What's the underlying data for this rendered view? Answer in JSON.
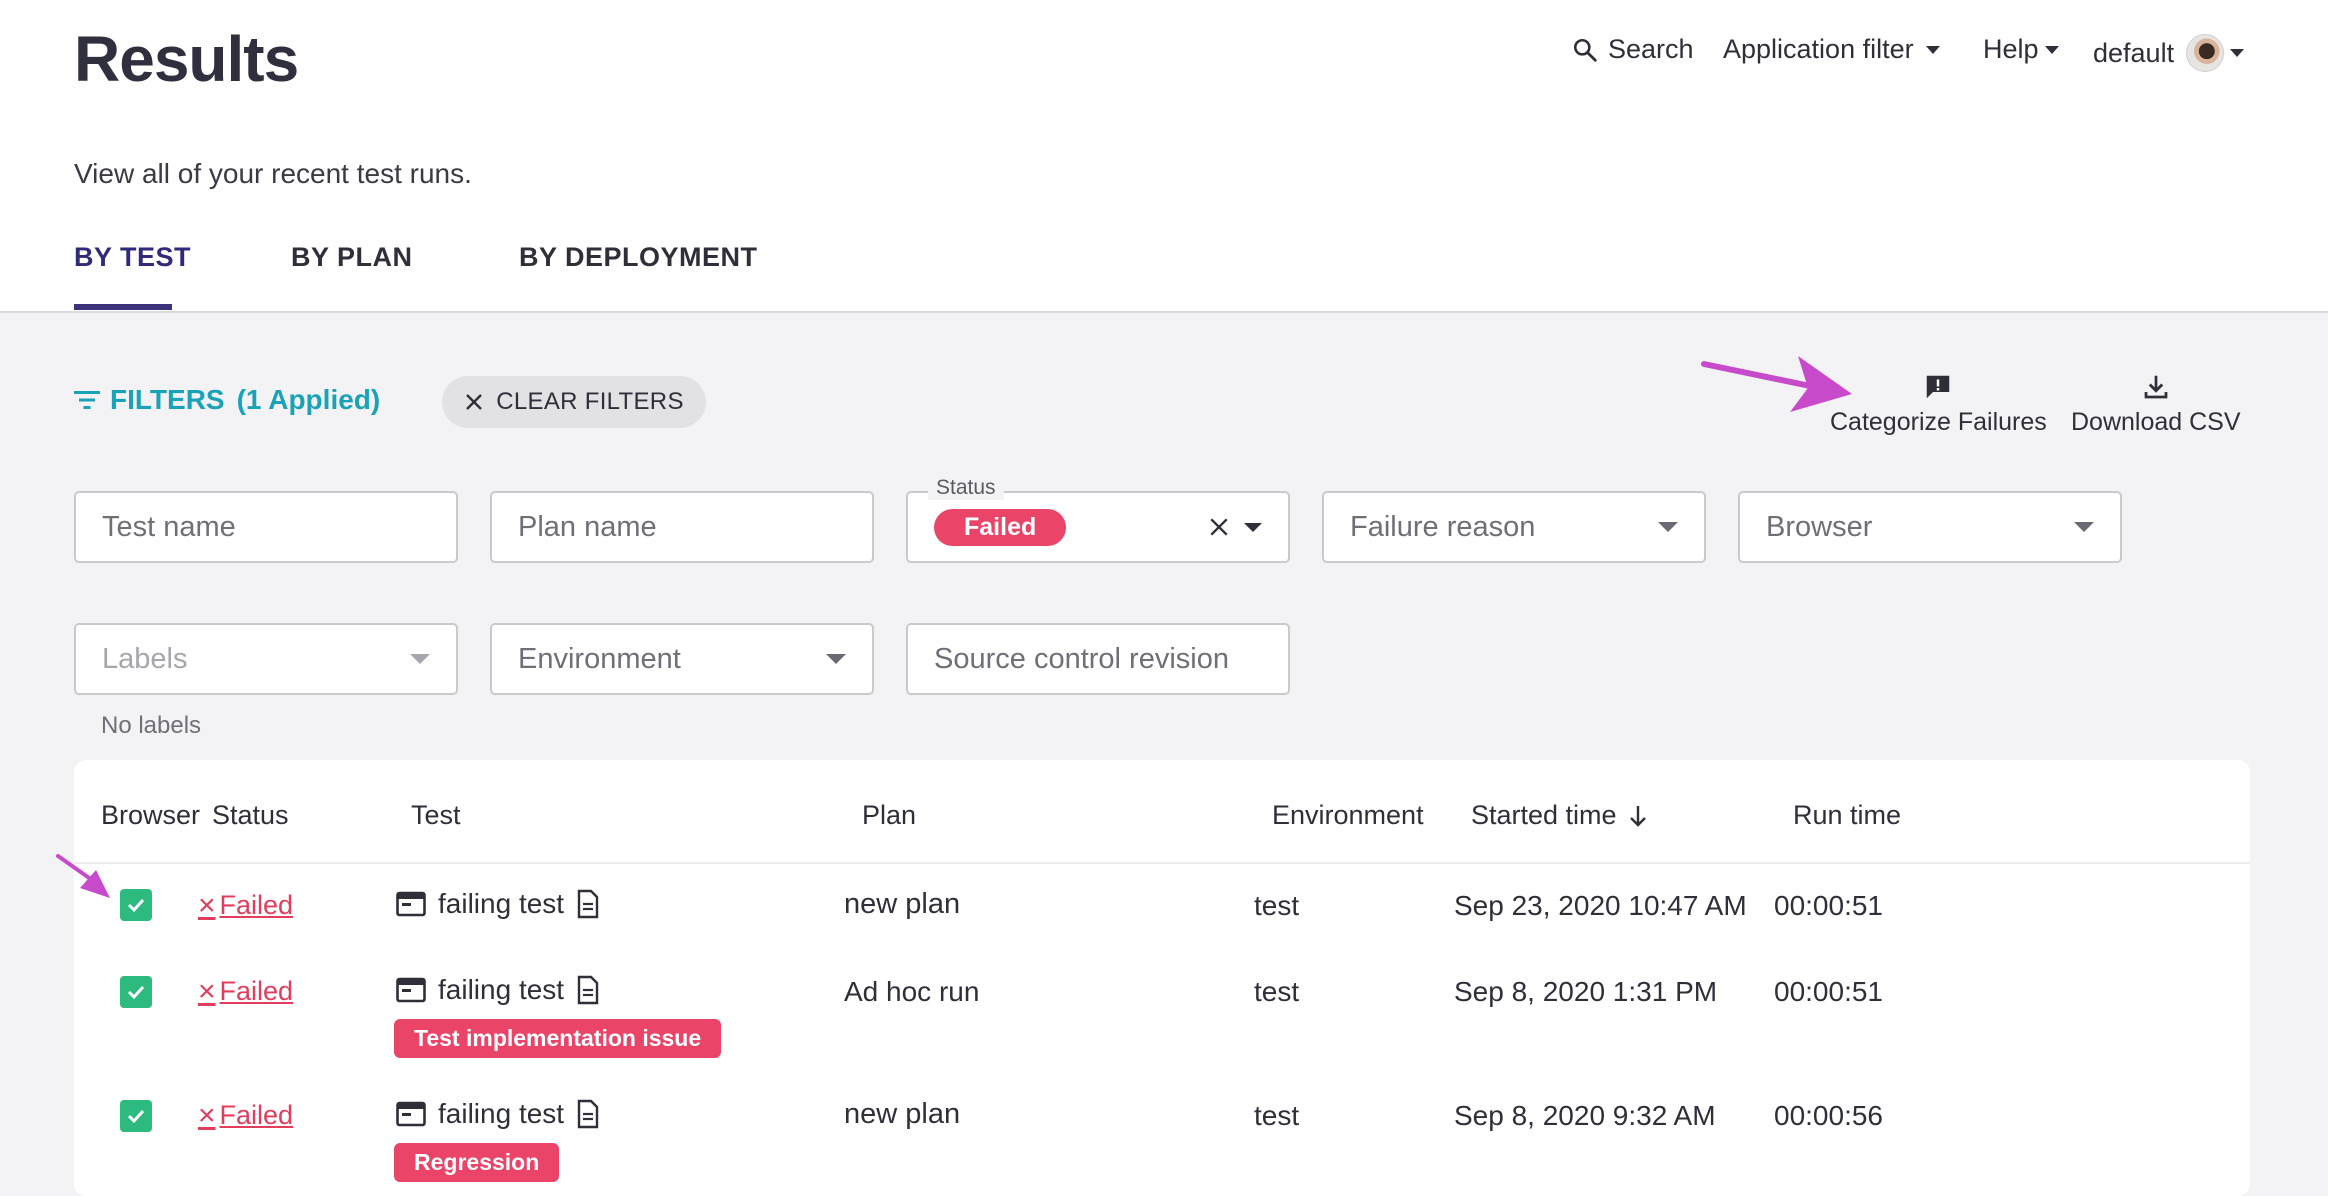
{
  "header": {
    "title": "Results",
    "subtitle": "View all of your recent test runs.",
    "nav": {
      "search_label": "Search",
      "app_filter_label": "Application filter",
      "help_label": "Help",
      "user_label": "default"
    }
  },
  "tabs": [
    {
      "label": "BY TEST",
      "active": true
    },
    {
      "label": "BY PLAN",
      "active": false
    },
    {
      "label": "BY DEPLOYMENT",
      "active": false
    }
  ],
  "filters": {
    "toggle_label": "FILTERS",
    "applied_label": "(1 Applied)",
    "clear_label": "CLEAR FILTERS",
    "test_name_placeholder": "Test name",
    "plan_name_placeholder": "Plan name",
    "status_legend": "Status",
    "status_value": "Failed",
    "failure_reason_placeholder": "Failure reason",
    "browser_placeholder": "Browser",
    "labels_placeholder": "Labels",
    "labels_helper": "No labels",
    "environment_placeholder": "Environment",
    "source_revision_placeholder": "Source control revision"
  },
  "actions": {
    "categorize_label": "Categorize Failures",
    "download_label": "Download CSV"
  },
  "table": {
    "headers": {
      "browser": "Browser",
      "status": "Status",
      "test": "Test",
      "plan": "Plan",
      "environment": "Environment",
      "started": "Started time",
      "run_time": "Run time"
    },
    "rows": [
      {
        "status": "Failed",
        "test": "failing test",
        "tag": "",
        "plan": "new plan",
        "environment": "test",
        "started": "Sep 23, 2020 10:47 AM",
        "run_time": "00:00:51"
      },
      {
        "status": "Failed",
        "test": "failing test",
        "tag": "Test implementation issue",
        "plan": "Ad hoc run",
        "environment": "test",
        "started": "Sep 8, 2020 1:31 PM",
        "run_time": "00:00:51"
      },
      {
        "status": "Failed",
        "test": "failing test",
        "tag": "Regression",
        "plan": "new plan",
        "environment": "test",
        "started": "Sep 8, 2020 9:32 AM",
        "run_time": "00:00:56"
      }
    ]
  },
  "colors": {
    "accent": "#3b327c",
    "filter_teal": "#1aa3b8",
    "failed_red": "#e23d5c",
    "tag_pink": "#ea4569",
    "checkbox_green": "#2dba7e",
    "annotation_magenta": "#c64ac9"
  }
}
